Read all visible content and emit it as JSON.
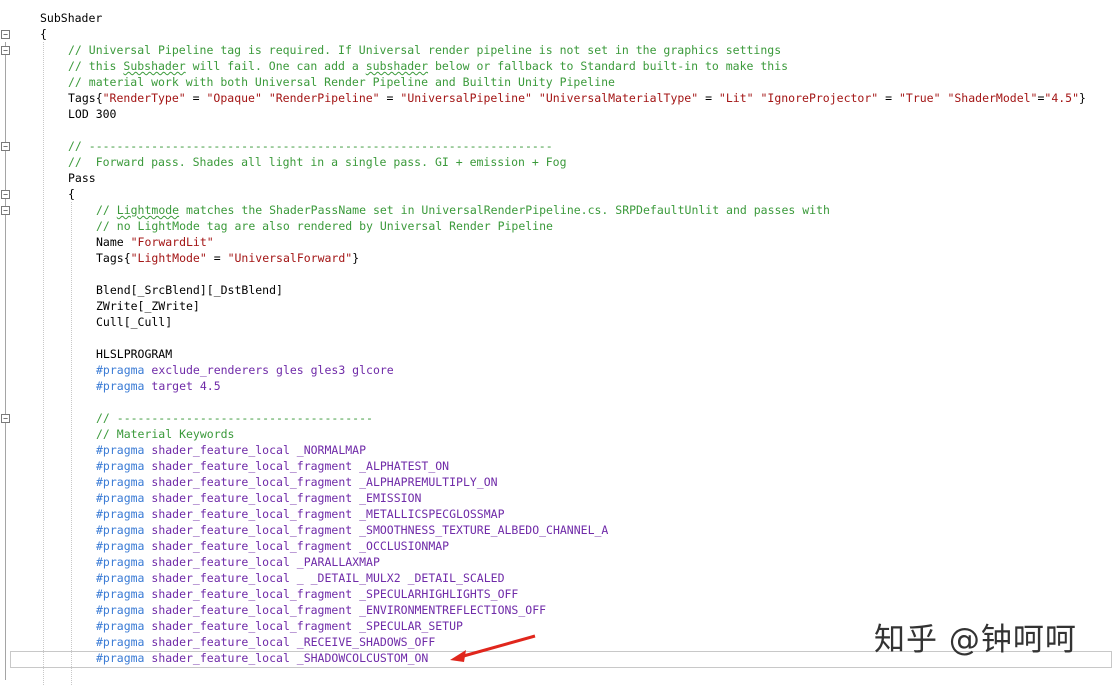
{
  "editor": {
    "lines": [
      {
        "text": "SubShader",
        "kind": "kw"
      },
      {
        "text": "{",
        "kind": "kw"
      },
      {
        "text": "// Universal Pipeline tag is required. If Universal render pipeline is not set in the graphics settings",
        "kind": "comment"
      },
      {
        "text": "// this Subshader will fail. One can add a subshader below or fallback to Standard built-in to make this",
        "kind": "comment"
      },
      {
        "text": "// material work with both Universal Render Pipeline and Builtin Unity Pipeline",
        "kind": "comment"
      },
      {
        "text": "Tags{\"RenderType\" = \"Opaque\" \"RenderPipeline\" = \"UniversalPipeline\" \"UniversalMaterialType\" = \"Lit\" \"IgnoreProjector\" = \"True\" \"ShaderModel\"=\"4.5\"}",
        "kind": "tags"
      },
      {
        "text": "LOD 300",
        "kind": "kw"
      },
      {
        "text": "",
        "kind": "kw"
      },
      {
        "text": "// -------------------------------------------------------------------",
        "kind": "comment"
      },
      {
        "text": "//  Forward pass. Shades all light in a single pass. GI + emission + Fog",
        "kind": "comment"
      },
      {
        "text": "Pass",
        "kind": "kw"
      },
      {
        "text": "{",
        "kind": "kw"
      },
      {
        "text": "// Lightmode matches the ShaderPassName set in UniversalRenderPipeline.cs. SRPDefaultUnlit and passes with",
        "kind": "comment"
      },
      {
        "text": "// no LightMode tag are also rendered by Universal Render Pipeline",
        "kind": "comment"
      },
      {
        "text": "Name \"ForwardLit\"",
        "kind": "name"
      },
      {
        "text": "Tags{\"LightMode\" = \"UniversalForward\"}",
        "kind": "tags"
      },
      {
        "text": "",
        "kind": "kw"
      },
      {
        "text": "Blend[_SrcBlend][_DstBlend]",
        "kind": "kw"
      },
      {
        "text": "ZWrite[_ZWrite]",
        "kind": "kw"
      },
      {
        "text": "Cull[_Cull]",
        "kind": "kw"
      },
      {
        "text": "",
        "kind": "kw"
      },
      {
        "text": "HLSLPROGRAM",
        "kind": "kw"
      },
      {
        "text": "#pragma exclude_renderers gles gles3 glcore",
        "kind": "pragma"
      },
      {
        "text": "#pragma target 4.5",
        "kind": "pragma"
      },
      {
        "text": "",
        "kind": "kw"
      },
      {
        "text": "// -------------------------------------",
        "kind": "comment"
      },
      {
        "text": "// Material Keywords",
        "kind": "comment"
      },
      {
        "text": "#pragma shader_feature_local _NORMALMAP",
        "kind": "pragma"
      },
      {
        "text": "#pragma shader_feature_local_fragment _ALPHATEST_ON",
        "kind": "pragma"
      },
      {
        "text": "#pragma shader_feature_local_fragment _ALPHAPREMULTIPLY_ON",
        "kind": "pragma"
      },
      {
        "text": "#pragma shader_feature_local_fragment _EMISSION",
        "kind": "pragma"
      },
      {
        "text": "#pragma shader_feature_local_fragment _METALLICSPECGLOSSMAP",
        "kind": "pragma"
      },
      {
        "text": "#pragma shader_feature_local_fragment _SMOOTHNESS_TEXTURE_ALBEDO_CHANNEL_A",
        "kind": "pragma"
      },
      {
        "text": "#pragma shader_feature_local_fragment _OCCLUSIONMAP",
        "kind": "pragma"
      },
      {
        "text": "#pragma shader_feature_local _PARALLAXMAP",
        "kind": "pragma"
      },
      {
        "text": "#pragma shader_feature_local _ _DETAIL_MULX2 _DETAIL_SCALED",
        "kind": "pragma"
      },
      {
        "text": "#pragma shader_feature_local_fragment _SPECULARHIGHLIGHTS_OFF",
        "kind": "pragma"
      },
      {
        "text": "#pragma shader_feature_local_fragment _ENVIRONMENTREFLECTIONS_OFF",
        "kind": "pragma"
      },
      {
        "text": "#pragma shader_feature_local_fragment _SPECULAR_SETUP",
        "kind": "pragma"
      },
      {
        "text": "#pragma shader_feature_local _RECEIVE_SHADOWS_OFF",
        "kind": "pragma"
      },
      {
        "text": "#pragma shader_feature_local _SHADOWCOLCUSTOM_ON",
        "kind": "pragma"
      }
    ]
  },
  "watermark": "知乎 @钟呵呵",
  "colors": {
    "comment": "#3b9a3b",
    "pragma": "#3a7bd5",
    "macro": "#6f2aa8",
    "string": "#a31515",
    "arrow": "#e0261c"
  }
}
